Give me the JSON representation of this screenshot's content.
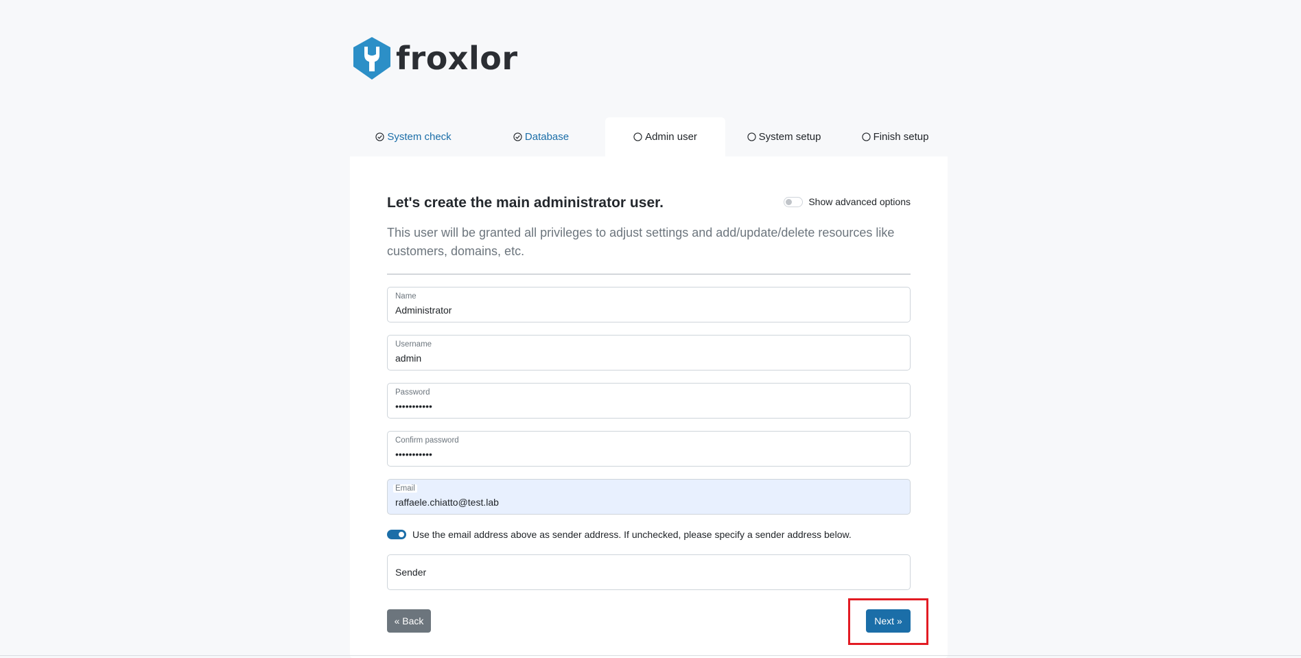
{
  "brand": {
    "name": "froxlor",
    "accent": "#1b6ea8",
    "logo_color": "#2c8fc7"
  },
  "steps": [
    {
      "label": "System check",
      "status": "done",
      "icon": "check-circle-icon"
    },
    {
      "label": "Database",
      "status": "done",
      "icon": "check-circle-icon"
    },
    {
      "label": "Admin user",
      "status": "active",
      "icon": "circle-icon"
    },
    {
      "label": "System setup",
      "status": "todo",
      "icon": "circle-icon"
    },
    {
      "label": "Finish setup",
      "status": "todo",
      "icon": "circle-icon"
    }
  ],
  "form": {
    "title": "Let's create the main administrator user.",
    "advanced_toggle_label": "Show advanced options",
    "lead": "This user will be granted all privileges to adjust settings and add/update/delete resources like customers, domains, etc.",
    "fields": {
      "name": {
        "label": "Name",
        "value": "Administrator"
      },
      "username": {
        "label": "Username",
        "value": "admin"
      },
      "password": {
        "label": "Password",
        "value": "•••••••••••"
      },
      "confirm_password": {
        "label": "Confirm password",
        "value": "•••••••••••"
      },
      "email": {
        "label": "Email",
        "value": "raffaele.chiatto@test.lab"
      },
      "sender": {
        "placeholder": "Sender"
      }
    },
    "use_email_as_sender": {
      "checked": true,
      "label": "Use the email address above as sender address. If unchecked, please specify a sender address below."
    },
    "back_label": "« Back",
    "next_label": "Next »"
  }
}
